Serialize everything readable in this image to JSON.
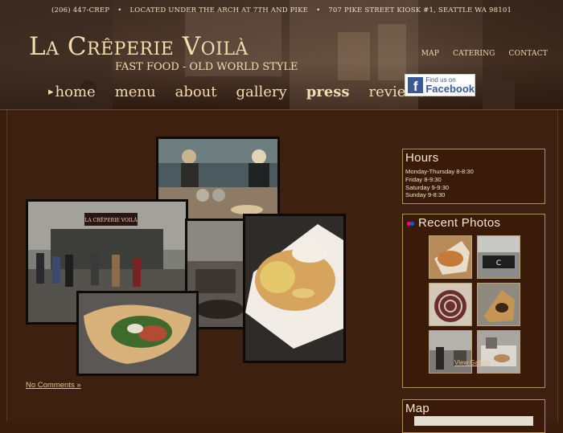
{
  "header": {
    "phone": "(206) 447-CREP",
    "location": "LOCATED UNDER THE ARCH AT 7TH AND PIKE",
    "address": "707 PIKE STREET KIOSK #1, SEATTLE WA 98101",
    "title": "La Crêperie Voilà",
    "tagline": "FAST FOOD - OLD WORLD STYLE",
    "util_nav": [
      "MAP",
      "CATERING",
      "CONTACT"
    ],
    "main_nav": [
      "home",
      "menu",
      "about",
      "gallery",
      "press",
      "reviews"
    ],
    "facebook": {
      "line1": "Find us on",
      "line2": "Facebook"
    }
  },
  "main": {
    "no_comments": "No Comments »"
  },
  "sidebar": {
    "hours": {
      "title": "Hours",
      "items": [
        "Monday-Thursday 8-8:30",
        "Friday 8-9:30",
        "Saturday 9-9:30",
        "Sunday 9-8:30"
      ]
    },
    "recent_photos": {
      "title": "Recent Photos",
      "view_gallery": "View Gallery"
    },
    "map": {
      "title": "Map"
    }
  },
  "colors": {
    "background": "#3b1f0e",
    "accent_text": "#f3dcae",
    "link": "#e7c48b",
    "box_border": "#b78f55"
  }
}
